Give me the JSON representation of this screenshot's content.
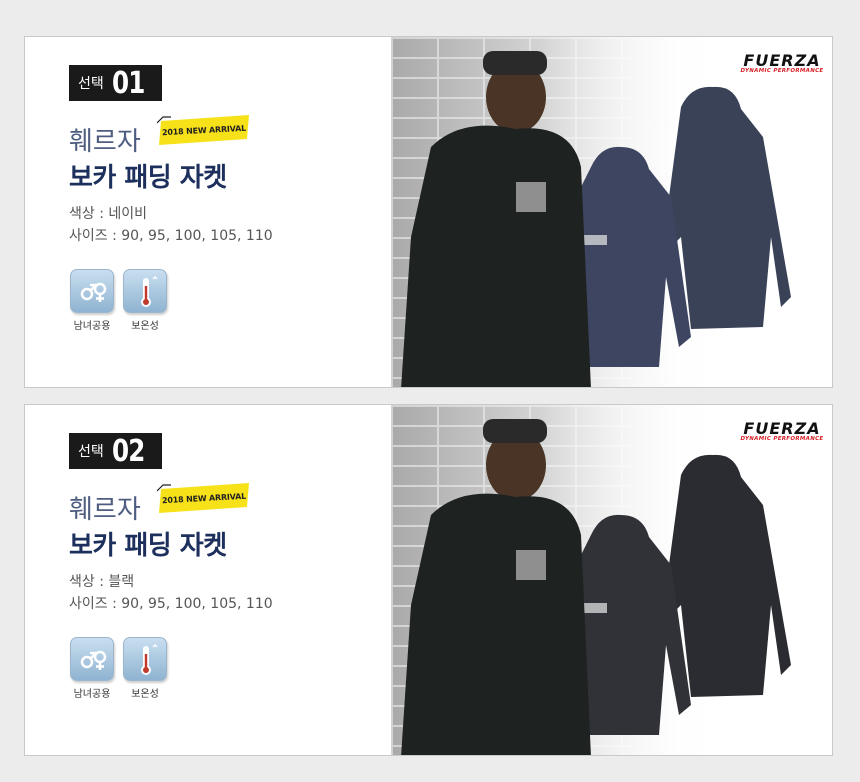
{
  "products": [
    {
      "select_label": "선택",
      "number": "01",
      "brand_ko": "훼르자",
      "arrival_tag": "2018 NEW ARRIVAL",
      "name_ko": "보카 패딩 자켓",
      "color_line": "색상 : 네이비",
      "size_line": "사이즈 : 90, 95, 100, 105, 110",
      "features": [
        {
          "icon": "gender-icon",
          "label": "남녀공용"
        },
        {
          "icon": "thermometer-icon",
          "label": "보온성"
        }
      ],
      "logo": {
        "brand": "FUERZA",
        "tagline": "DYNAMIC PERFORMANCE"
      },
      "jacket_color": "#3a4258"
    },
    {
      "select_label": "선택",
      "number": "02",
      "brand_ko": "훼르자",
      "arrival_tag": "2018 NEW ARRIVAL",
      "name_ko": "보카 패딩 자켓",
      "color_line": "색상 : 블랙",
      "size_line": "사이즈 : 90, 95, 100, 105, 110",
      "features": [
        {
          "icon": "gender-icon",
          "label": "남녀공용"
        },
        {
          "icon": "thermometer-icon",
          "label": "보온성"
        }
      ],
      "logo": {
        "brand": "FUERZA",
        "tagline": "DYNAMIC PERFORMANCE"
      },
      "jacket_color": "#2a2c31"
    }
  ],
  "colors": {
    "background": "#ececec",
    "brand_text": "#4e5d80",
    "product_text": "#1d2f5c",
    "arrival_tag_bg": "#f7e21a",
    "logo_accent": "#d61f26"
  }
}
